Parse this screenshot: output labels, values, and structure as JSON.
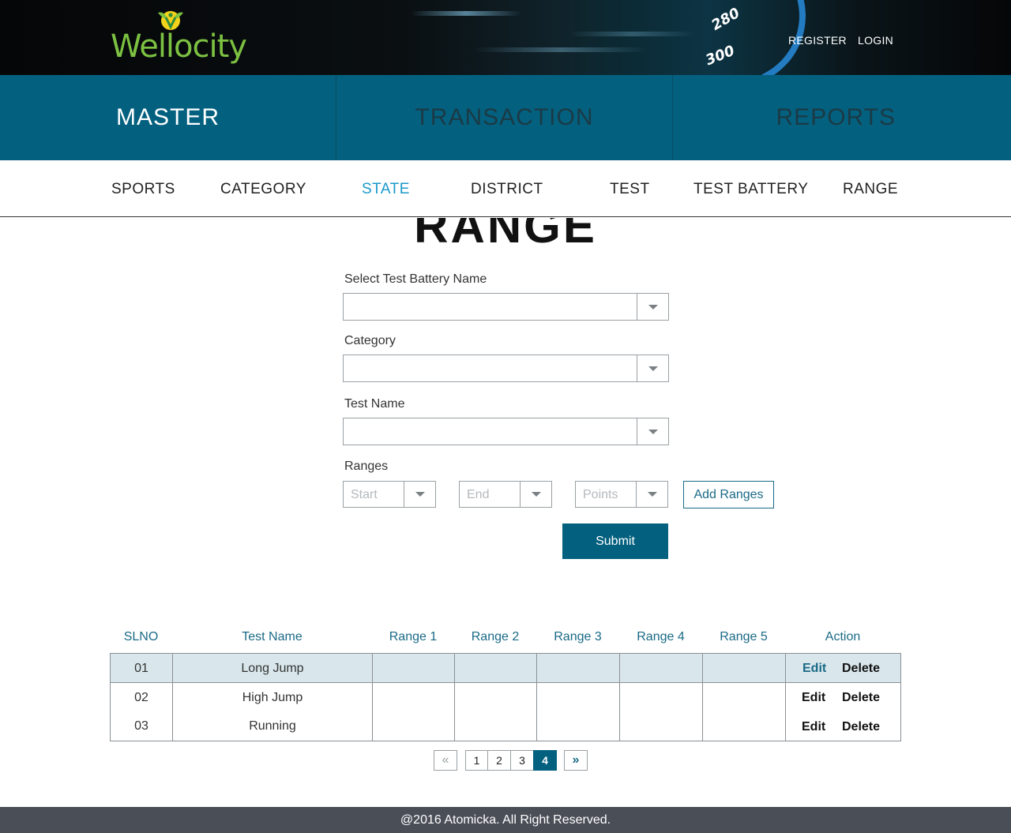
{
  "header": {
    "brand": "Wellocity",
    "speed_marks": [
      "280",
      "300"
    ],
    "register_label": "REGISTER",
    "login_label": "LOGIN"
  },
  "main_tabs": [
    {
      "label": "MASTER",
      "active": true
    },
    {
      "label": "TRANSACTION",
      "active": false
    },
    {
      "label": "REPORTS",
      "active": false
    }
  ],
  "sub_nav": [
    {
      "label": "SPORTS",
      "active": false
    },
    {
      "label": "CATEGORY",
      "active": false
    },
    {
      "label": "STATE",
      "active": true
    },
    {
      "label": "DISTRICT",
      "active": false
    },
    {
      "label": "TEST",
      "active": false
    },
    {
      "label": "TEST BATTERY",
      "active": false
    },
    {
      "label": "RANGE",
      "active": false
    }
  ],
  "page_title": "RANGE",
  "form": {
    "battery_label": "Select Test Battery Name",
    "battery_value": "",
    "category_label": "Category",
    "category_value": "",
    "test_name_label": "Test Name",
    "test_name_value": "",
    "ranges_label": "Ranges",
    "start_placeholder": "Start",
    "end_placeholder": "End",
    "points_placeholder": "Points",
    "add_ranges_label": "Add Ranges",
    "submit_label": "Submit"
  },
  "table": {
    "columns": [
      "SLNO",
      "Test Name",
      "Range 1",
      "Range 2",
      "Range 3",
      "Range 4",
      "Range 5",
      "Action"
    ],
    "rows": [
      {
        "slno": "01",
        "test_name": "Long Jump",
        "ranges": [
          "",
          "",
          "",
          "",
          ""
        ]
      },
      {
        "slno": "02",
        "test_name": "High Jump",
        "ranges": [
          "",
          "",
          "",
          "",
          ""
        ]
      },
      {
        "slno": "03",
        "test_name": "Running",
        "ranges": [
          "",
          "",
          "",
          "",
          ""
        ]
      }
    ],
    "edit_label": "Edit",
    "delete_label": "Delete"
  },
  "pagination": {
    "prev_label": "«",
    "next_label": "»",
    "pages": [
      "1",
      "2",
      "3",
      "4"
    ],
    "current_page": "4"
  },
  "footer": {
    "text": "@2016 Atomicka. All Right Reserved."
  },
  "colors": {
    "primary": "#03607f",
    "active_link": "#1b99c9",
    "brand_green": "#7cc141",
    "footer_bg": "#4a4e57"
  }
}
